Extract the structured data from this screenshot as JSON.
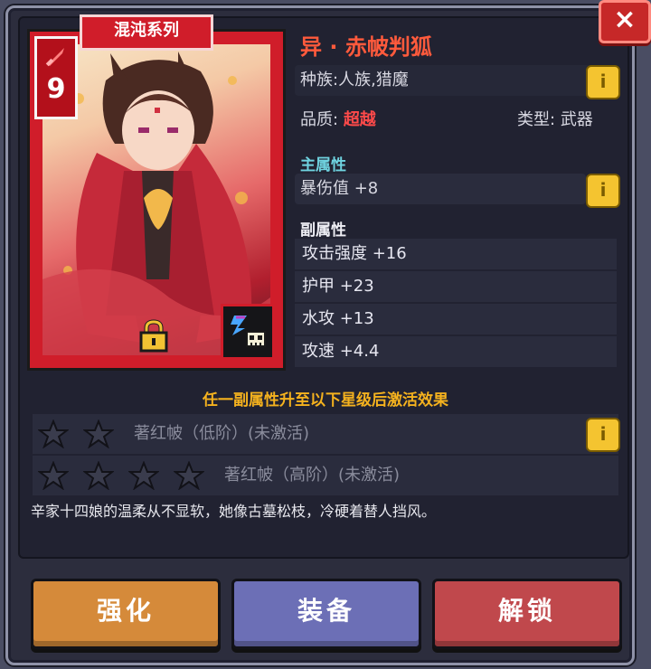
{
  "close_label": "×",
  "card": {
    "series": "混沌系列",
    "level": "9",
    "icons": {
      "type": "sword-icon",
      "lock": "padlock-icon",
      "element": "water-skull-icon"
    }
  },
  "info": {
    "name": "异 · 赤帔判狐",
    "race": "种族:人族,猎魔",
    "quality_label": "品质:",
    "quality_value": "超越",
    "type_label": "类型:",
    "type_value": "武器",
    "main_attr_title": "主属性",
    "main_attr": "暴伤值 +8",
    "sub_attr_title": "副属性",
    "sub_attrs": [
      "攻击强度 +16",
      "护甲 +23",
      "水攻 +13",
      "攻速 +4.4"
    ]
  },
  "activation": {
    "title": "任一副属性升至以下星级后激活效果",
    "sets": [
      {
        "stars": 2,
        "label": "著红帔（低阶）(未激活)"
      },
      {
        "stars": 4,
        "label": "著红帔（高阶）(未激活)"
      }
    ]
  },
  "description": "辛家十四娘的温柔从不显软，她像古墓松枝，冷硬着替人挡风。",
  "buttons": {
    "strengthen": "强化",
    "equip": "装备",
    "unlock": "解锁"
  },
  "colors": {
    "name": "#ff5a3c",
    "quality": "#ff4a4a",
    "main_attr_title": "#6fd3e0",
    "activation_title": "#f5b21e",
    "card_border": "#d01d2a"
  }
}
